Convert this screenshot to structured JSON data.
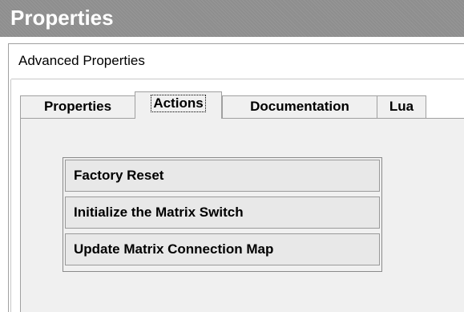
{
  "window": {
    "title": "Properties"
  },
  "section": {
    "label": "Advanced Properties"
  },
  "tabs": [
    {
      "label": "Properties",
      "active": false
    },
    {
      "label": "Actions",
      "active": true
    },
    {
      "label": "Documentation",
      "active": false
    },
    {
      "label": "Lua",
      "active": false
    }
  ],
  "actions": [
    {
      "label": "Factory Reset"
    },
    {
      "label": "Initialize the Matrix Switch"
    },
    {
      "label": "Update Matrix Connection Map"
    }
  ],
  "colors": {
    "title_bar": "#8e8e8e",
    "panel": "#f0f0f0",
    "button": "#e8e8e8",
    "border": "#a0a0a0"
  }
}
